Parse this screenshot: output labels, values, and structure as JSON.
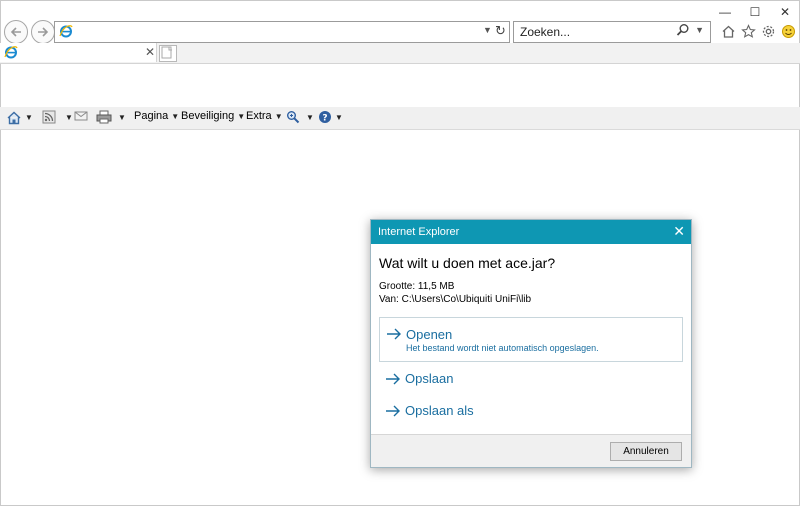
{
  "window": {
    "minimize_glyph": "—",
    "maximize_glyph": "☐",
    "close_glyph": "✕"
  },
  "address_bar": {
    "value": ""
  },
  "search": {
    "placeholder": "Zoeken..."
  },
  "tab": {
    "title": "",
    "close_glyph": "✕"
  },
  "command_bar": {
    "pagina": "Pagina",
    "beveiliging": "Beveiliging",
    "extra": "Extra"
  },
  "dialog": {
    "title": "Internet Explorer",
    "close_glyph": "✕",
    "question": "Wat wilt u doen met ace.jar?",
    "size_line": "Grootte: 11,5 MB",
    "from_line": "Van: C:\\Users\\Co\\Ubiquiti UniFi\\lib",
    "options": [
      {
        "label": "Openen",
        "sub": "Het bestand wordt niet automatisch opgeslagen."
      },
      {
        "label": "Opslaan"
      },
      {
        "label": "Opslaan als"
      }
    ],
    "cancel_label": "Annuleren"
  },
  "colors": {
    "dialog_title_bg": "#0e97b3",
    "link_blue": "#1a6ea0",
    "ie_logo": "#1b8bd1"
  },
  "icons": [
    "back-icon",
    "forward-icon",
    "ie-logo-icon",
    "refresh-icon",
    "search-icon",
    "home-icon",
    "favorites-star-icon",
    "gear-icon",
    "smiley-icon",
    "feeds-icon",
    "mail-icon",
    "print-icon",
    "research-icon",
    "help-icon"
  ]
}
